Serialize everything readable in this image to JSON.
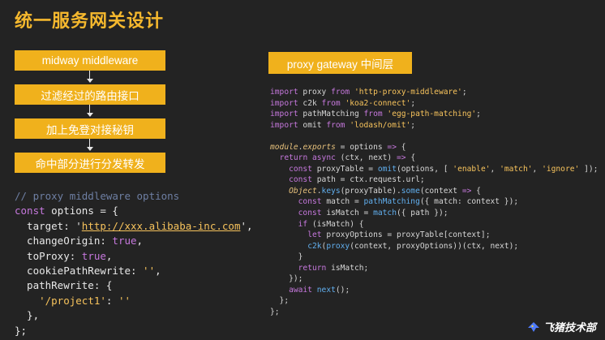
{
  "slide": {
    "title": "统一服务网关设计"
  },
  "flow": {
    "steps": [
      "midway middleware",
      "过滤经过的路由接口",
      "加上免登对接秘钥",
      "命中部分进行分发转发"
    ]
  },
  "proxy": {
    "label": "proxy gateway 中间层"
  },
  "code_left": {
    "lines": [
      "// proxy middleware options",
      "const options = {",
      "  target: 'http://xxx.alibaba-inc.com',",
      "  changeOrigin: true,",
      "  toProxy: true,",
      "  cookiePathRewrite: '',",
      "  pathRewrite: {",
      "    '/project1': ''",
      "  },",
      "};"
    ]
  },
  "code_right": {
    "lines": [
      "import proxy from 'http-proxy-middleware';",
      "import c2k from 'koa2-connect';",
      "import pathMatching from 'egg-path-matching';",
      "import omit from 'lodash/omit';",
      "",
      "module.exports = options => {",
      "  return async (ctx, next) => {",
      "    const proxyTable = omit(options, [ 'enable', 'match', 'ignore' ]);",
      "    const path = ctx.request.url;",
      "    Object.keys(proxyTable).some(context => {",
      "      const match = pathMatching({ match: context });",
      "      const isMatch = match({ path });",
      "      if (isMatch) {",
      "        let proxyOptions = proxyTable[context];",
      "        c2k(proxy(context, proxyOptions))(ctx, next);",
      "      }",
      "      return isMatch;",
      "    });",
      "    await next();",
      "  };",
      "};"
    ]
  },
  "brand": {
    "name": "飞猪技术部",
    "icon": "fliggy-logo-icon"
  },
  "colors": {
    "background": "#232323",
    "accent": "#f0b11c",
    "title": "#f5b82e"
  }
}
